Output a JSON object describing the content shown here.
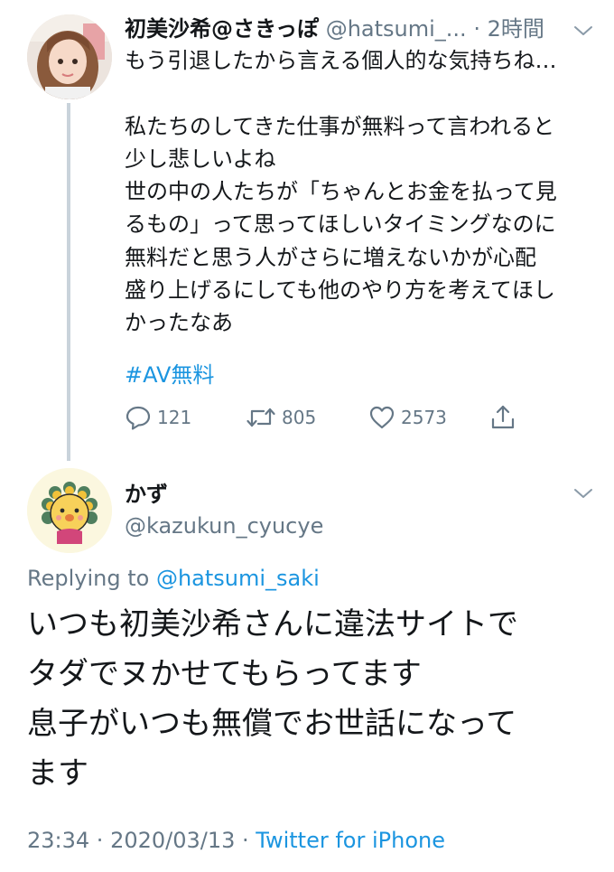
{
  "colors": {
    "text": "#14171a",
    "secondary": "#657786",
    "link": "#1b95e0",
    "thread_line": "#c9d3db"
  },
  "original_tweet": {
    "display_name": "初美沙希@さきっぽ",
    "handle": "@hatsumi_...",
    "separator": "·",
    "time": "2時間",
    "text_lines": [
      "もう引退したから言える個人的な気持ちね…",
      "",
      "私たちのしてきた仕事が無料って言われると",
      "少し悲しいよね",
      "世の中の人たちが「ちゃんとお金を払って見",
      "るもの」って思ってほしいタイミングなのに",
      "無料だと思う人がさらに増えないかが心配",
      "盛り上げるにしても他のやり方を考えてほし",
      "かったなあ"
    ],
    "hashtag": "#AV無料",
    "actions": {
      "reply": {
        "icon": "reply-icon",
        "count": "121"
      },
      "retweet": {
        "icon": "retweet-icon",
        "count": "805"
      },
      "like": {
        "icon": "heart-icon",
        "count": "2573"
      },
      "share": {
        "icon": "share-icon"
      }
    }
  },
  "reply_tweet": {
    "display_name": "かず",
    "handle": "@kazukun_cyucye",
    "replying_prefix": "Replying to ",
    "replying_to": "@hatsumi_saki",
    "text_lines": [
      "いつも初美沙希さんに違法サイトで",
      "タダでヌかせてもらってます",
      "息子がいつも無償でお世話になって",
      "ます"
    ],
    "time": "23:34",
    "meta_separator_1": " · ",
    "date": "2020/03/13",
    "meta_separator_2": " · ",
    "source": "Twitter for iPhone"
  }
}
